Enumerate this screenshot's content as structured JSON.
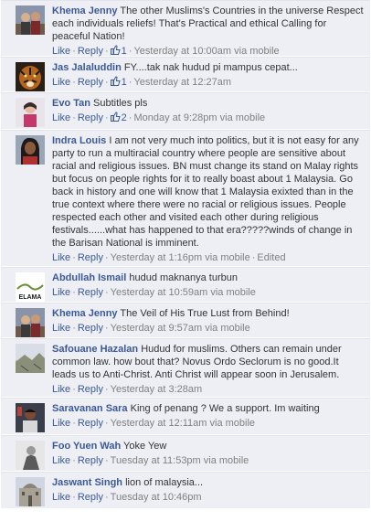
{
  "colors": {
    "link": "#3b5998",
    "background": "#edeff4",
    "meta": "#808080"
  },
  "actions": {
    "like": "Like",
    "reply": "Reply",
    "separator": "·"
  },
  "comments": [
    {
      "author": "Khema Jenny",
      "text": "The other Muslims's Countries in the universe Respect each individuals reliefs! That's Practical and ethical Calling for peaceful Nation!",
      "like_count": "1",
      "timestamp": "Yesterday at 10:00am via mobile",
      "edited": "",
      "avatar_icon": "person-avatar-icon"
    },
    {
      "author": "Jas Jalaluddin",
      "text": "FY....tak nak hudud pi mampus cepat...",
      "like_count": "1",
      "timestamp": "Yesterday at 12:27am",
      "edited": "",
      "avatar_icon": "tiger-avatar-icon"
    },
    {
      "author": "Evo Tan",
      "text": "Subtitles pls",
      "like_count": "2",
      "timestamp": "Monday at 9:28pm via mobile",
      "edited": "",
      "avatar_icon": "person-avatar-icon"
    },
    {
      "author": "Indra Louis",
      "text": "I am not very much into politics, but it is not easy for any party to run a multiracial country where people are sensitive about racial and religious issues. BN must change its stand on Malay rights but focus on people rights for it to really boast about 1 Malaysia. Go back in history and one will know that 1 Malaysia exixted than in the true context where there were no racial or religious issues. People respected each other and visited each other during religious festivals......what has happened to that era?????winds of change in the Barisan National is imminent.",
      "like_count": "",
      "timestamp": "Yesterday at 1:16pm via mobile",
      "edited": "Edited",
      "avatar_icon": "person-avatar-icon"
    },
    {
      "author": "Abdullah Ismail",
      "text": "hudud maknanya turbun",
      "like_count": "",
      "timestamp": "Yesterday at 10:59am via mobile",
      "edited": "",
      "avatar_icon": "elama-logo-icon",
      "avatar_text": "ELAMA"
    },
    {
      "author": "Khema Jenny",
      "text": "The Veil of His True Lust from Behind!",
      "like_count": "",
      "timestamp": "Yesterday at 9:57am via mobile",
      "edited": "",
      "avatar_icon": "person-avatar-icon"
    },
    {
      "author": "Safouane Hazalan",
      "text": "Hudud for muslims. Others can remain under common law. how bout that? Novus Ordo Seclorum is no good.It leads us to Anti-Christ. Anti Christ will appear soon in Jerusalem.",
      "like_count": "",
      "timestamp": "Yesterday at 3:28am",
      "edited": "",
      "avatar_icon": "landscape-avatar-icon"
    },
    {
      "author": "Saravanan Sara",
      "text": "King of penang ? We a support. Im waiting",
      "like_count": "",
      "timestamp": "Yesterday at 12:11am via mobile",
      "edited": "",
      "avatar_icon": "person-avatar-icon"
    },
    {
      "author": "Foo Yuen Wah",
      "text": "Yoke Yew",
      "like_count": "",
      "timestamp": "Tuesday at 11:53pm via mobile",
      "edited": "",
      "avatar_icon": "person-avatar-icon"
    },
    {
      "author": "Jaswant Singh",
      "text": "lion of malaysia...",
      "like_count": "",
      "timestamp": "Tuesday at 10:46pm",
      "edited": "",
      "avatar_icon": "building-avatar-icon"
    }
  ]
}
